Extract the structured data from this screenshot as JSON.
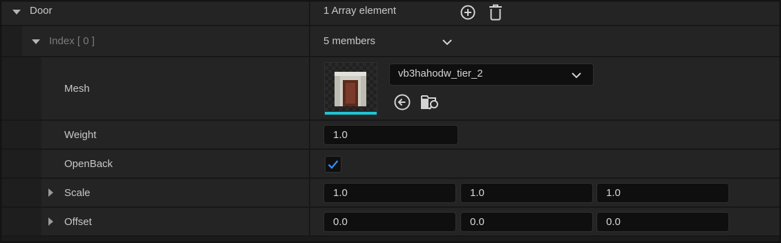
{
  "door": {
    "label": "Door",
    "value": "1 Array element",
    "add_icon": "add-circle-icon",
    "delete_icon": "trash-icon"
  },
  "index": {
    "label": "Index [ 0 ]",
    "value": "5 members",
    "chevron_icon": "chevron-down-icon"
  },
  "mesh": {
    "label": "Mesh",
    "asset": "vb3hahodw_tier_2",
    "thumbnail_icon": "mesh-thumbnail",
    "use_selected_icon": "arrow-left-circle-icon",
    "browse_icon": "folder-search-icon",
    "accent_color": "#1fc5d4"
  },
  "weight": {
    "label": "Weight",
    "value": "1.0"
  },
  "openback": {
    "label": "OpenBack",
    "checked": true,
    "check_color": "#2f8bff"
  },
  "scale": {
    "label": "Scale",
    "x": "1.0",
    "y": "1.0",
    "z": "1.0"
  },
  "offset": {
    "label": "Offset",
    "x": "0.0",
    "y": "0.0",
    "z": "0.0"
  }
}
